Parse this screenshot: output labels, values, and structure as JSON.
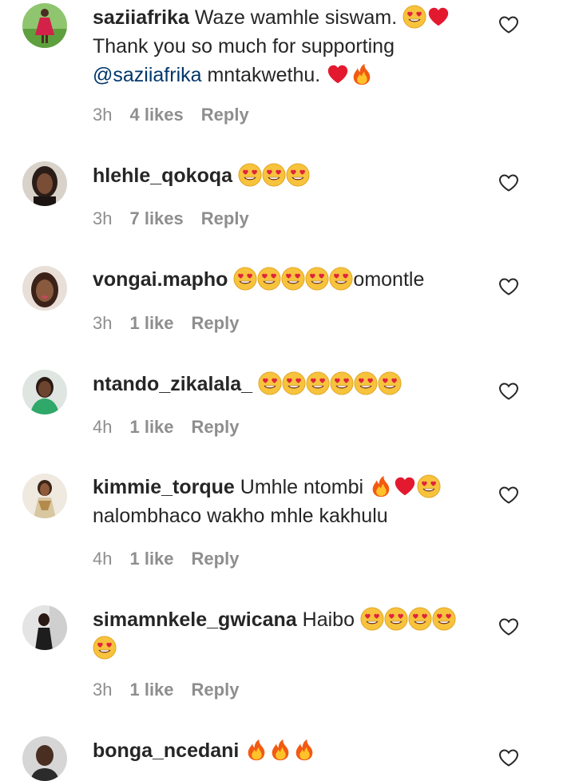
{
  "comments": [
    {
      "username": "saziiafrika",
      "text_parts": [
        "Waze wamhle siswam. ",
        "Thank you so much for supporting ",
        "@saziiafrika",
        " mntakwethu. "
      ],
      "time": "3h",
      "likes": "4 likes",
      "reply": "Reply",
      "emojis_after_first": [
        "heart-eyes",
        "red-heart"
      ],
      "emojis_end": [
        "red-heart",
        "fire"
      ]
    },
    {
      "username": "hlehle_qokoqa",
      "time": "3h",
      "likes": "7 likes",
      "reply": "Reply",
      "emojis": [
        "heart-eyes",
        "heart-eyes",
        "heart-eyes"
      ]
    },
    {
      "username": "vongai.mapho",
      "text_after": "omontle",
      "time": "3h",
      "likes": "1 like",
      "reply": "Reply",
      "emojis": [
        "heart-eyes",
        "heart-eyes",
        "heart-eyes",
        "heart-eyes",
        "heart-eyes"
      ]
    },
    {
      "username": "ntando_zikalala_",
      "time": "4h",
      "likes": "1 like",
      "reply": "Reply",
      "emojis": [
        "heart-eyes",
        "heart-eyes",
        "heart-eyes",
        "heart-eyes",
        "heart-eyes",
        "heart-eyes"
      ]
    },
    {
      "username": "kimmie_torque",
      "text": "Umhle ntombi ",
      "text_line2": "nalombhaco wakho mhle kakhulu",
      "time": "4h",
      "likes": "1 like",
      "reply": "Reply",
      "emojis": [
        "fire",
        "red-heart",
        "heart-eyes"
      ]
    },
    {
      "username": "simamnkele_gwicana",
      "text": "Haibo ",
      "time": "3h",
      "likes": "1 like",
      "reply": "Reply",
      "emojis": [
        "heart-eyes",
        "heart-eyes",
        "heart-eyes",
        "heart-eyes",
        "heart-eyes"
      ]
    },
    {
      "username": "bonga_ncedani",
      "emojis": [
        "fire",
        "fire",
        "fire"
      ]
    }
  ],
  "colors": {
    "text": "#262626",
    "meta": "#8e8e8e",
    "mention": "#00376b",
    "heart_outline": "#262626"
  }
}
